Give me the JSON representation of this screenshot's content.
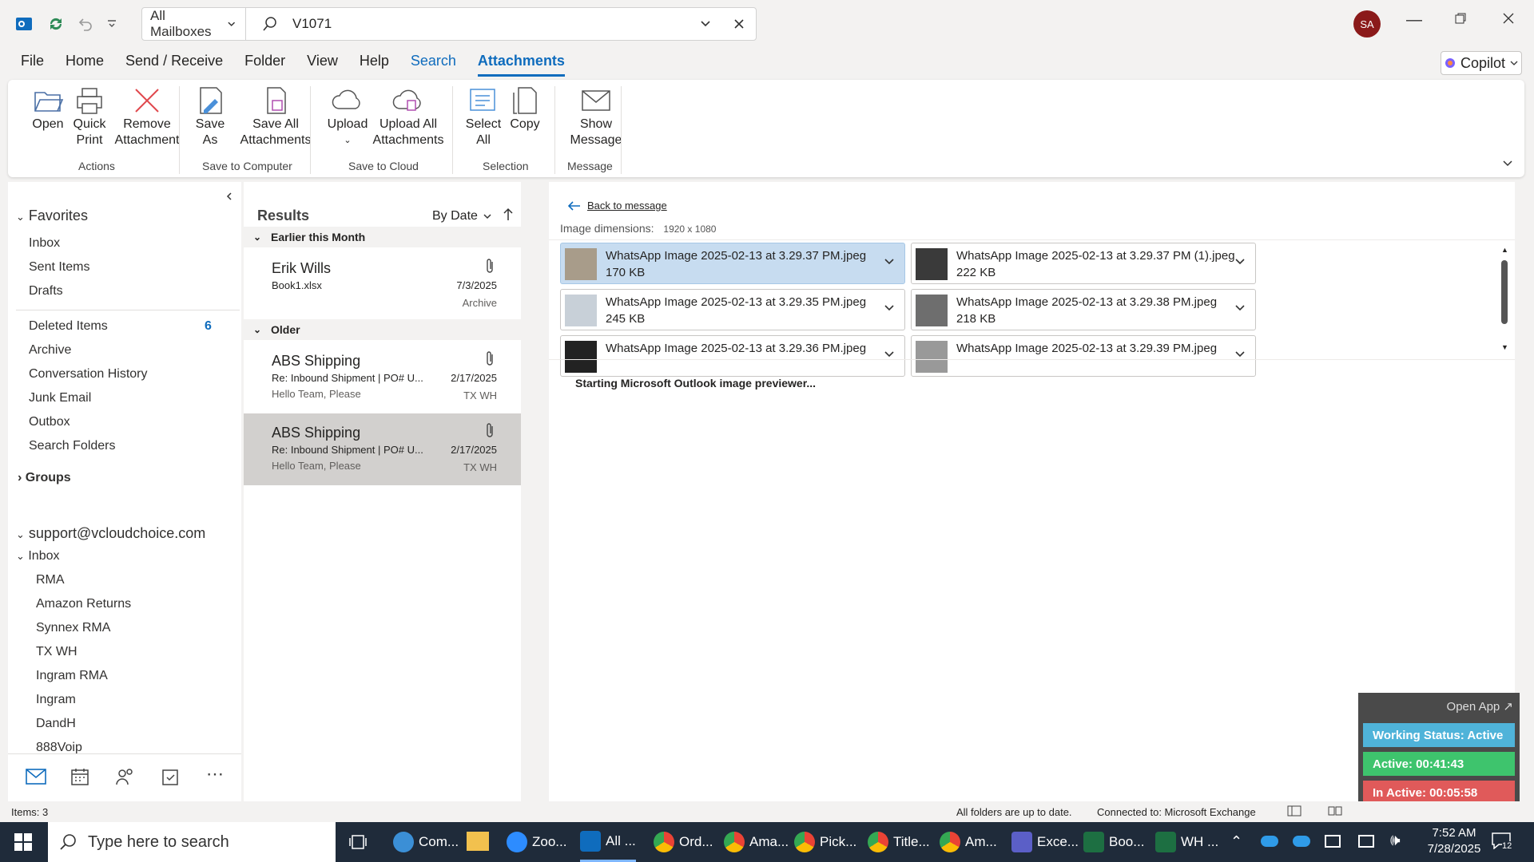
{
  "titlebar": {
    "scope": "All Mailboxes",
    "query": "V1071",
    "avatar": "SA"
  },
  "menu": {
    "tabs": [
      "File",
      "Home",
      "Send / Receive",
      "Folder",
      "View",
      "Help",
      "Search",
      "Attachments"
    ],
    "copilot": "Copilot"
  },
  "ribbon": {
    "open": "Open",
    "quick_print_1": "Quick",
    "quick_print_2": "Print",
    "remove_1": "Remove",
    "remove_2": "Attachment",
    "saveas_1": "Save",
    "saveas_2": "As",
    "saveall_1": "Save All",
    "saveall_2": "Attachments",
    "upload": "Upload",
    "uploadall_1": "Upload All",
    "uploadall_2": "Attachments",
    "selectall_1": "Select",
    "selectall_2": "All",
    "copy": "Copy",
    "show_1": "Show",
    "show_2": "Message",
    "groups": {
      "actions": "Actions",
      "save_computer": "Save to Computer",
      "save_cloud": "Save to Cloud",
      "selection": "Selection",
      "message": "Message"
    }
  },
  "nav": {
    "favorites": "Favorites",
    "inbox": "Inbox",
    "sent": "Sent Items",
    "drafts": "Drafts",
    "deleted": "Deleted Items",
    "deleted_count": "6",
    "archive": "Archive",
    "conv_history": "Conversation History",
    "junk": "Junk Email",
    "outbox": "Outbox",
    "search_folders": "Search Folders",
    "groups": "Groups",
    "account": "support@vcloudchoice.com",
    "acct_inbox": "Inbox",
    "subfolders": [
      "RMA",
      "Amazon Returns",
      "Synnex RMA",
      "TX WH",
      "Ingram RMA",
      "Ingram",
      "DandH",
      "888Voip"
    ]
  },
  "results": {
    "title": "Results",
    "sort": "By Date",
    "group1": "Earlier this Month",
    "group2": "Older",
    "mails": [
      {
        "from": "Erik Wills",
        "subject": "Book1.xlsx",
        "preview": "",
        "date": "7/3/2025",
        "folder": "Archive"
      },
      {
        "from": "ABS Shipping",
        "subject": "Re: Inbound Shipment | PO# U...",
        "preview": "Hello Team,  Please",
        "date": "2/17/2025",
        "folder": "TX WH"
      },
      {
        "from": "ABS Shipping",
        "subject": "Re: Inbound Shipment | PO# U...",
        "preview": "Hello Team,  Please",
        "date": "2/17/2025",
        "folder": "TX WH"
      }
    ]
  },
  "reader": {
    "back": "Back to message",
    "dims_label": "Image dimensions:",
    "dims": "1920 x 1080",
    "attachments": [
      {
        "name": "WhatsApp Image 2025-02-13 at 3.29.37 PM.jpeg",
        "size": "170 KB"
      },
      {
        "name": "WhatsApp Image 2025-02-13 at 3.29.37 PM (1).jpeg",
        "size": "222 KB"
      },
      {
        "name": "WhatsApp Image 2025-02-13 at 3.29.35 PM.jpeg",
        "size": "245 KB"
      },
      {
        "name": "WhatsApp Image 2025-02-13 at 3.29.38 PM.jpeg",
        "size": "218 KB"
      },
      {
        "name": "WhatsApp Image 2025-02-13 at 3.29.36 PM.jpeg",
        "size": ""
      },
      {
        "name": "WhatsApp Image 2025-02-13 at 3.29.39 PM.jpeg",
        "size": ""
      }
    ],
    "previewer": "Starting Microsoft Outlook image previewer..."
  },
  "status": {
    "items": "Items: 3",
    "sync": "All folders are up to date.",
    "connection": "Connected to: Microsoft Exchange"
  },
  "widget": {
    "open_app": "Open App ↗",
    "working": "Working Status: Active",
    "active": "Active: 00:41:43",
    "inactive": "In Active: 00:05:58"
  },
  "taskbar": {
    "search": "Type here to search",
    "apps": [
      "Com...",
      "Zoo...",
      "All ...",
      "Ord...",
      "Ama...",
      "Pick...",
      "Title...",
      "Am...",
      "Exce...",
      "Boo...",
      "WH ..."
    ],
    "time": "7:52 AM",
    "date": "7/28/2025",
    "notif": "12"
  },
  "colors": {
    "accent": "#0f6cbd",
    "active_green": "#3ec46d",
    "inactive_red": "#e05a5a",
    "status_blue": "#4fb3d9"
  }
}
